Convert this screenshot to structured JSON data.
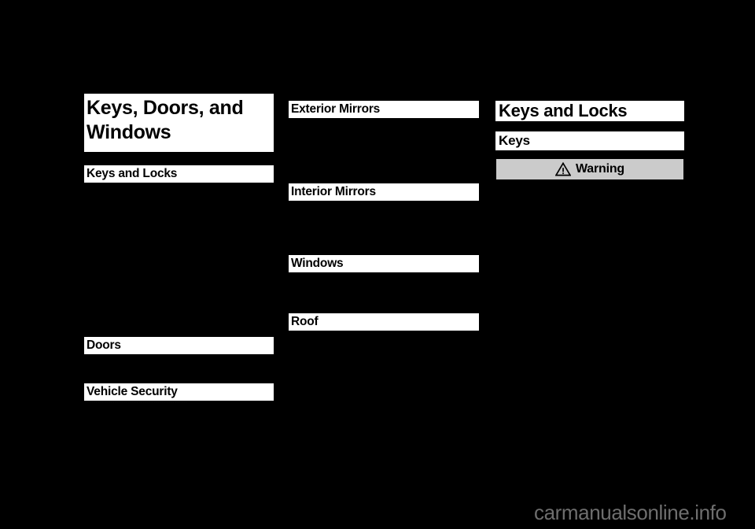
{
  "page": {
    "background_color": "#000000",
    "text_color": "#000000",
    "bar_color": "#ffffff"
  },
  "chapter_title": {
    "line1": "Keys, Doors, and",
    "line2": "Windows"
  },
  "columns": {
    "left": {
      "headings": [
        {
          "label": "Keys and Locks"
        },
        {
          "label": "Doors"
        },
        {
          "label": "Vehicle Security"
        }
      ],
      "ghost_text": "................................................"
    },
    "middle": {
      "headings": [
        {
          "label": "Exterior Mirrors"
        },
        {
          "label": "Interior Mirrors"
        },
        {
          "label": "Windows"
        },
        {
          "label": "Roof"
        }
      ]
    },
    "right": {
      "chapter_heading": "Keys and Locks",
      "sub_heading": "Keys",
      "warning": {
        "label": "Warning",
        "icon": "warning-triangle-icon",
        "background_color": "#cbcbcb",
        "border_color": "#000000"
      }
    }
  },
  "footer": {
    "watermark": "carmanualsonline.info",
    "watermark_color": "#6e6e6e"
  }
}
